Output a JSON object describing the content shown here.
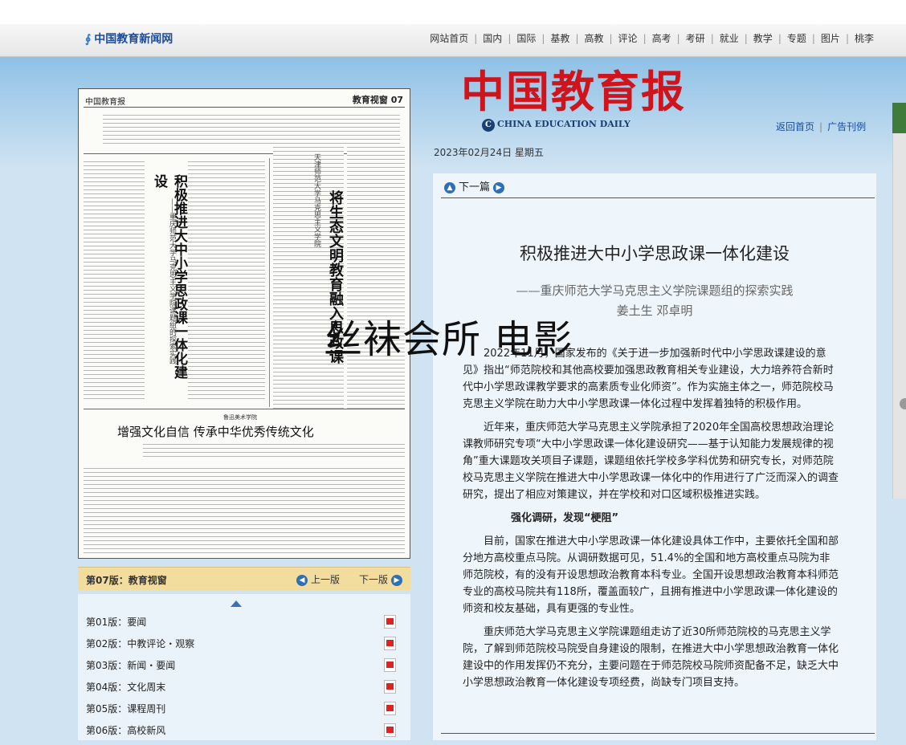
{
  "header": {
    "site_logo": "中国教育新闻网",
    "nav": [
      "网站首页",
      "国内",
      "国际",
      "基教",
      "高教",
      "评论",
      "高考",
      "考研",
      "就业",
      "教学",
      "专题",
      "图片",
      "桃李"
    ]
  },
  "masthead": {
    "title_cn": "中国教育报",
    "title_en": "CHINA EDUCATION DAILY",
    "links": [
      "返回首页",
      "广告刊例"
    ],
    "date": "2023年02月24日  星期五"
  },
  "paper": {
    "header_left": "中国教育报",
    "header_right": "教育视窗 07",
    "headline1": "积极推进大中小学思政课一体化建设",
    "headline1_sub": "——重庆师范大学马克思主义学院课题组的探索实践",
    "headline2": "将生态文明教育融入思政课",
    "headline2_org": "天津师范大学马克思主义学院",
    "banner": "增强文化自信  传承中华优秀传统文化",
    "banner_org": "鲁迅美术学院"
  },
  "pagebar": {
    "title": "第07版：教育视窗",
    "prev": "上一版",
    "next": "下一版"
  },
  "page_list": [
    {
      "label": "第01版：要闻"
    },
    {
      "label": "第02版：中教评论・观察"
    },
    {
      "label": "第03版：新闻・要闻"
    },
    {
      "label": "第04版：文化周末"
    },
    {
      "label": "第05版：课程周刊"
    },
    {
      "label": "第06版：高校新风"
    }
  ],
  "article": {
    "nav_next": "下一篇",
    "title": "积极推进大中小学思政课一体化建设",
    "subtitle": "——重庆师范大学马克思主义学院课题组的探索实践",
    "authors": "姜土生  邓卓明",
    "paragraphs": [
      "2022年11月，国家发布的《关于进一步加强新时代中小学思政课建设的意见》指出“师范院校和其他高校要加强思政教育相关专业建设，大力培养符合新时代中小学思政课教学要求的高素质专业化师资”。作为实施主体之一，师范院校马克思主义学院在助力大中小学思政课一体化过程中发挥着独特的积极作用。",
      "近年来，重庆师范大学马克思主义学院承担了2020年全国高校思想政治理论课教师研究专项“大中小学思政课一体化建设研究——基于认知能力发展规律的视角”重大课题攻关项目子课题，课题组依托学校多学科优势和研究专长，对师范院校马克思主义学院在推进大中小学思政课一体化中的作用进行了广泛而深入的调查研究，提出了相应对策建议，并在学校和对口区域积极推进实践。"
    ],
    "section_head": "强化调研，发现“梗阻”",
    "paragraphs2": [
      "目前，国家在推进大中小学思政课一体化建设具体工作中，主要依托全国和部分地方高校重点马院。从调研数据可见，51.4%的全国和地方高校重点马院为非师范院校，有的没有开设思想政治教育本科专业。全国开设思想政治教育本科师范专业的高校马院共有118所，覆盖面较广，且拥有推进中小学思政课一体化建设的师资和校友基础，具有更强的专业性。",
      "重庆师范大学马克思主义学院课题组走访了近30所师范院校的马克思主义学院，了解到师范院校马院受自身建设的限制，在推进大中小学思想政治教育一体化建设中的作用发挥仍不充分，主要问题在于师范院校马院师资配备不足，缺乏大中小学思想政治教育一体化建设专项经费，尚缺专门项目支持。"
    ]
  },
  "overlay_text": "丝袜会所 电影"
}
